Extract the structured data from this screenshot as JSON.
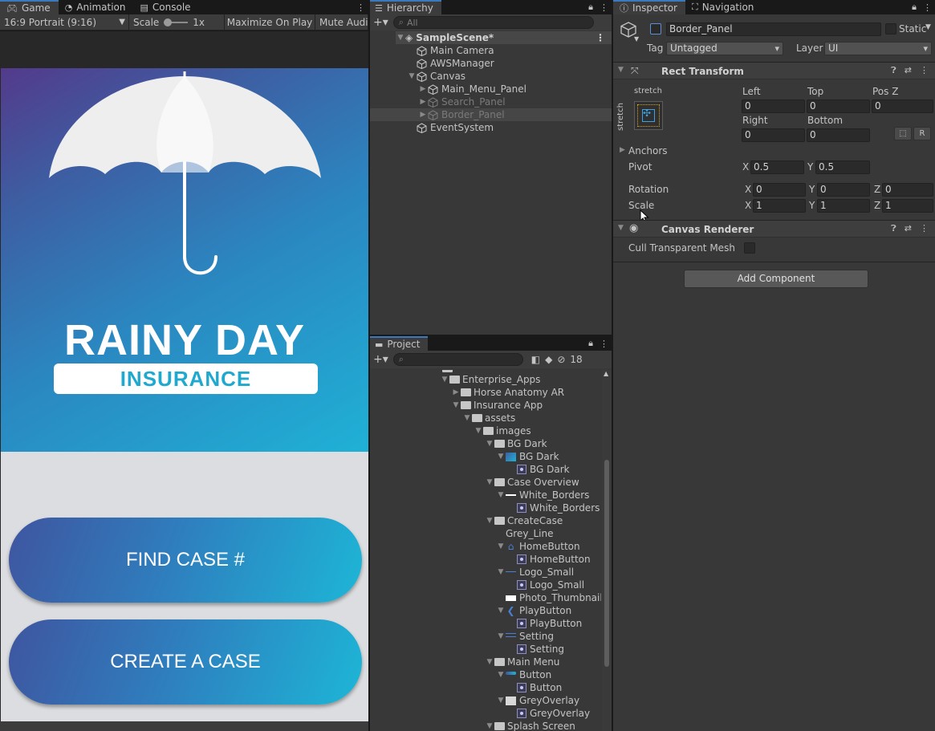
{
  "game": {
    "tabs": [
      {
        "label": "Game",
        "icon": "gamepad-icon"
      },
      {
        "label": "Animation",
        "icon": "animation-icon"
      },
      {
        "label": "Console",
        "icon": "console-icon"
      }
    ],
    "toolbar": {
      "aspect": "16:9 Portrait (9:16)",
      "scale_label": "Scale",
      "scale_value": "1x",
      "maximize": "Maximize On Play",
      "mute": "Mute Audio"
    },
    "app": {
      "title": "RAINY DAY",
      "subtitle": "INSURANCE",
      "button1": "FIND CASE #",
      "button2": "CREATE A CASE",
      "colors": {
        "gradient_start": "#533a8b",
        "gradient_end": "#1fb1d6",
        "subtitle": "#1fa9cf"
      }
    }
  },
  "hierarchy": {
    "tab": "Hierarchy",
    "search_placeholder": "All",
    "items": [
      {
        "label": "SampleScene*"
      },
      {
        "label": "Main Camera"
      },
      {
        "label": "AWSManager"
      },
      {
        "label": "Canvas"
      },
      {
        "label": "Main_Menu_Panel"
      },
      {
        "label": "Search_Panel"
      },
      {
        "label": "Border_Panel"
      },
      {
        "label": "EventSystem"
      }
    ]
  },
  "project": {
    "tab": "Project",
    "hidden_count": "18",
    "items": [
      {
        "label": "Enterprise_Apps"
      },
      {
        "label": "Horse Anatomy AR"
      },
      {
        "label": "Insurance App"
      },
      {
        "label": "assets"
      },
      {
        "label": "images"
      },
      {
        "label": "BG Dark"
      },
      {
        "label": "BG Dark"
      },
      {
        "label": "BG Dark"
      },
      {
        "label": "Case Overview"
      },
      {
        "label": "White_Borders"
      },
      {
        "label": "White_Borders"
      },
      {
        "label": "CreateCase"
      },
      {
        "label": "Grey_Line"
      },
      {
        "label": "HomeButton"
      },
      {
        "label": "HomeButton"
      },
      {
        "label": "Logo_Small"
      },
      {
        "label": "Logo_Small"
      },
      {
        "label": "Photo_Thumbnail"
      },
      {
        "label": "PlayButton"
      },
      {
        "label": "PlayButton"
      },
      {
        "label": "Setting"
      },
      {
        "label": "Setting"
      },
      {
        "label": "Main Menu"
      },
      {
        "label": "Button"
      },
      {
        "label": "Button"
      },
      {
        "label": "GreyOverlay"
      },
      {
        "label": "GreyOverlay"
      },
      {
        "label": "Splash Screen"
      }
    ]
  },
  "inspector": {
    "tabs": [
      {
        "label": "Inspector",
        "icon": "info-icon"
      },
      {
        "label": "Navigation",
        "icon": "navigation-icon"
      }
    ],
    "object_name": "Border_Panel",
    "static_label": "Static",
    "tag_label": "Tag",
    "tag_value": "Untagged",
    "layer_label": "Layer",
    "layer_value": "UI",
    "rect_transform": {
      "title": "Rect Transform",
      "anchor_preset_label": "stretch",
      "anchor_preset_side": "stretch",
      "left_label": "Left",
      "left": "0",
      "top_label": "Top",
      "top": "0",
      "posz_label": "Pos Z",
      "posz": "0",
      "right_label": "Right",
      "right": "0",
      "bottom_label": "Bottom",
      "bottom": "0",
      "r_button": "R",
      "anchors_label": "Anchors",
      "pivot_label": "Pivot",
      "pivot_x": "0.5",
      "pivot_y": "0.5",
      "rotation_label": "Rotation",
      "rot_x": "0",
      "rot_y": "0",
      "rot_z": "0",
      "scale_label": "Scale",
      "scale_x": "1",
      "scale_y": "1",
      "scale_z": "1",
      "axis_x": "X",
      "axis_y": "Y",
      "axis_z": "Z"
    },
    "canvas_renderer": {
      "title": "Canvas Renderer",
      "cull_label": "Cull Transparent Mesh"
    },
    "add_component": "Add Component"
  }
}
